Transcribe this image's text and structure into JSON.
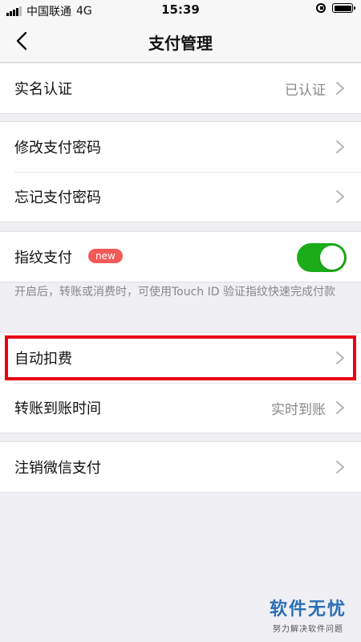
{
  "status_bar": {
    "carrier": "中国联通",
    "network": "4G",
    "time": "15:39"
  },
  "nav": {
    "title": "支付管理"
  },
  "groups": [
    [
      {
        "label": "实名认证",
        "value": "已认证"
      }
    ],
    [
      {
        "label": "修改支付密码"
      },
      {
        "label": "忘记支付密码"
      }
    ],
    [
      {
        "label": "指纹支付",
        "badge": "new",
        "toggle_on": true
      }
    ],
    [
      {
        "label": "自动扣费"
      },
      {
        "label": "转账到账时间",
        "value": "实时到账"
      }
    ],
    [
      {
        "label": "注销微信支付"
      }
    ]
  ],
  "fingerprint_note": "开启后，转账或消费时，可使用Touch ID 验证指纹快速完成付款",
  "watermark": {
    "main": "软件无忧",
    "sub": "努力解决软件问题"
  },
  "colors": {
    "switch_on": "#1aad19",
    "badge": "#f25a5a",
    "highlight": "#e60012",
    "watermark": "#2a6fb5"
  }
}
